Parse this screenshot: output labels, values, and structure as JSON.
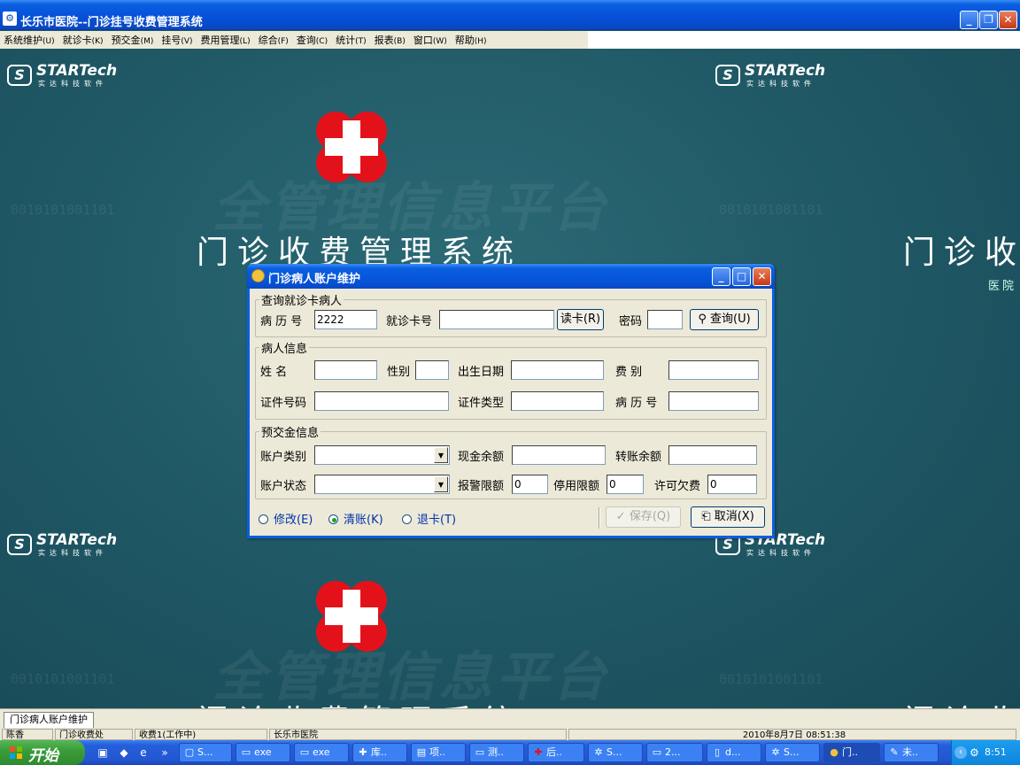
{
  "window": {
    "title": "长乐市医院--门诊挂号收费管理系统",
    "minimize": "_",
    "restore": "❐",
    "close": "✕"
  },
  "menu": [
    {
      "label": "系统维护",
      "hotkey": "(U)"
    },
    {
      "label": "就诊卡",
      "hotkey": "(K)"
    },
    {
      "label": "预交金",
      "hotkey": "(M)"
    },
    {
      "label": "挂号",
      "hotkey": "(V)"
    },
    {
      "label": "费用管理",
      "hotkey": "(L)"
    },
    {
      "label": "综合",
      "hotkey": "(F)"
    },
    {
      "label": "查询",
      "hotkey": "(C)"
    },
    {
      "label": "统计",
      "hotkey": "(T)"
    },
    {
      "label": "报表",
      "hotkey": "(B)"
    },
    {
      "label": "窗口",
      "hotkey": "(W)"
    },
    {
      "label": "帮助",
      "hotkey": "(H)"
    }
  ],
  "background": {
    "logo_brand": "STARTech",
    "logo_sub": "实达科技软件",
    "system_title": "门诊收费管理系统",
    "system_title_partial": "门诊收",
    "watermark": "全管理信息平台",
    "binary": "0010101001101",
    "hospital_partial": "医院"
  },
  "dialog": {
    "title": "门诊病人账户维护",
    "query_group": {
      "legend": "查询就诊卡病人",
      "record_no_label": "病 历 号",
      "record_no_value": "2222",
      "card_no_label": "就诊卡号",
      "card_no_value": "",
      "read_card_button": "读卡(R)",
      "password_label": "密码",
      "password_value": "",
      "query_button": "查询(U)"
    },
    "patient_group": {
      "legend": "病人信息",
      "name_label": "姓    名",
      "gender_label": "性别",
      "birthdate_label": "出生日期",
      "fee_type_label": "费    别",
      "id_no_label": "证件号码",
      "id_type_label": "证件类型",
      "record_no_label": "病 历 号"
    },
    "deposit_group": {
      "legend": "预交金信息",
      "account_type_label": "账户类别",
      "account_type_value": "",
      "cash_balance_label": "现金余额",
      "cash_balance_value": "",
      "transfer_balance_label": "转账余额",
      "transfer_balance_value": "",
      "account_status_label": "账户状态",
      "account_status_value": "",
      "alarm_limit_label": "报警限额",
      "alarm_limit_value": "0",
      "stop_limit_label": "停用限额",
      "stop_limit_value": "0",
      "allowed_arrears_label": "许可欠费",
      "allowed_arrears_value": "0"
    },
    "modes": {
      "modify": "修改(E)",
      "settle": "清账(K)",
      "return_card": "退卡(T)",
      "selected": "settle"
    },
    "save_button": "保存(Q)",
    "cancel_button": "取消(X)"
  },
  "doc_tab": "门诊病人账户维护",
  "status": {
    "cell1": "陈香",
    "cell2": "门诊收费处",
    "cell3": "收费1(工作中)",
    "cell4": "长乐市医院",
    "cell5": "2010年8月7日 08:51:38"
  },
  "taskbar": {
    "start": "开始",
    "tasks": [
      "S...",
      "exe",
      "exe",
      "库..",
      "项..",
      "测..",
      "后..",
      "S...",
      "2...",
      "d...",
      "S...",
      "门..",
      "未.."
    ],
    "clock": "8:51"
  },
  "colors": {
    "desktop": "#1f5764",
    "title_blue": "#0a5fe0",
    "red_cross": "#e3121a",
    "dialog_face": "#ece9d8"
  }
}
